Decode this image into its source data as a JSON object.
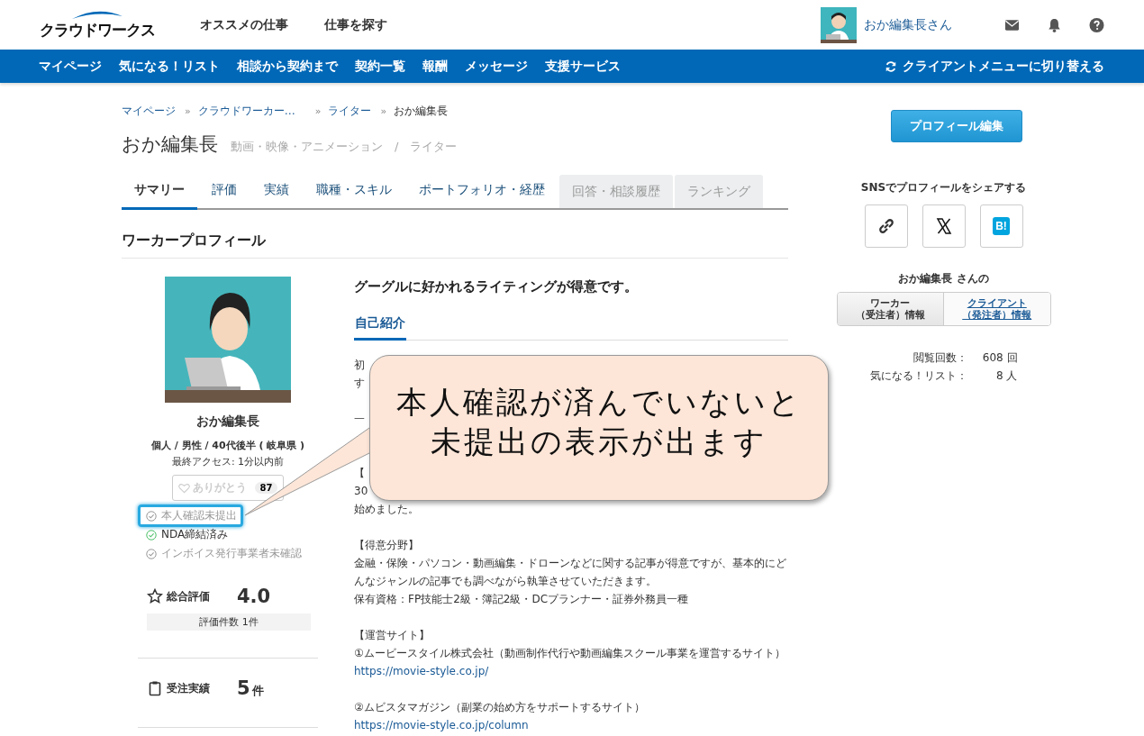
{
  "header": {
    "logo": "クラウドワークス",
    "links": [
      "オススメの仕事",
      "仕事を探す"
    ],
    "user": "おか編集長さん"
  },
  "nav": {
    "items": [
      "マイページ",
      "気になる！リスト",
      "相談から契約まで",
      "契約一覧",
      "報酬",
      "メッセージ",
      "支援サービス"
    ],
    "switch": "クライアントメニューに切り替える"
  },
  "breadcrumb": {
    "separator": "»",
    "items": [
      {
        "label": "マイページ",
        "link": true
      },
      {
        "label": "クラウドワーカー…",
        "link": true
      },
      {
        "label": "ライター",
        "link": true
      },
      {
        "label": "おか編集長",
        "link": false
      }
    ]
  },
  "title": {
    "name": "おか編集長",
    "category": "動画・映像・アニメーション　/　ライター"
  },
  "tabs": [
    {
      "label": "サマリー",
      "selected": true,
      "disabled": false
    },
    {
      "label": "評価",
      "selected": false,
      "disabled": false
    },
    {
      "label": "実績",
      "selected": false,
      "disabled": false
    },
    {
      "label": "職種・スキル",
      "selected": false,
      "disabled": false
    },
    {
      "label": "ポートフォリオ・経歴",
      "selected": false,
      "disabled": false
    },
    {
      "label": "回答・相談履歴",
      "selected": false,
      "disabled": true
    },
    {
      "label": "ランキング",
      "selected": false,
      "disabled": true
    }
  ],
  "section_title": "ワーカープロフィール",
  "profile": {
    "name": "おか編集長",
    "attributes": "個人 / 男性 / 40代後半 ( 岐阜県 )",
    "last_access": "最終アクセス: 1分以内前",
    "thanks": {
      "label": "ありがとう",
      "count": "87"
    },
    "badges": [
      {
        "label": "本人確認未提出",
        "verified": false,
        "highlighted": true
      },
      {
        "label": "NDA締結済み",
        "verified": true,
        "highlighted": false
      },
      {
        "label": "インボイス発行事業者未確認",
        "verified": false,
        "highlighted": false
      }
    ],
    "rating": {
      "label": "総合評価",
      "value": "4.0",
      "count": "評価件数 1件"
    },
    "orders": {
      "label": "受注実績",
      "value": "5",
      "unit": "件"
    }
  },
  "headline": "グーグルに好かれるライティングが得意です。",
  "intro_tab": "自己紹介",
  "bio": [
    {
      "lines": [
        {
          "kind": "text",
          "text": "初"
        },
        {
          "kind": "text",
          "text": "す"
        }
      ]
    },
    {
      "lines": [
        {
          "kind": "text",
          "text": "一"
        }
      ]
    },
    {
      "lines": [
        {
          "kind": "text",
          "text": "【"
        },
        {
          "kind": "text",
          "text": "30"
        },
        {
          "kind": "text",
          "text": "始めました。"
        }
      ]
    },
    {
      "lines": [
        {
          "kind": "text",
          "text": "【得意分野】"
        },
        {
          "kind": "text",
          "text": "金融・保険・パソコン・動画編集・ドローンなどに関する記事が得意ですが、基本的にど"
        },
        {
          "kind": "text",
          "text": "んなジャンルの記事でも調べながら執筆させていただきます。"
        },
        {
          "kind": "text",
          "text": "保有資格：FP技能士2級・簿記2級・DCプランナー・証券外務員一種"
        }
      ]
    },
    {
      "lines": [
        {
          "kind": "text",
          "text": "【運営サイト】"
        },
        {
          "kind": "text",
          "text": "①ムービースタイル株式会社（動画制作代行や動画編集スクール事業を運営するサイト）"
        },
        {
          "kind": "link",
          "text": "https://movie-style.co.jp/"
        }
      ]
    },
    {
      "lines": [
        {
          "kind": "text",
          "text": "②ムビスタマガジン（副業の始め方をサポートするサイト）"
        },
        {
          "kind": "link",
          "text": "https://movie-style.co.jp/column"
        }
      ]
    }
  ],
  "callout": {
    "lines": [
      "本人確認が済んでいないと",
      "未提出の表示が出ます"
    ]
  },
  "sidebar": {
    "edit_button": "プロフィール編集",
    "share_title": "SNSでプロフィールをシェアする",
    "share_buttons": [
      {
        "kind": "link"
      },
      {
        "kind": "x"
      },
      {
        "kind": "hatena",
        "label": "B!"
      }
    ],
    "role_title": "おか編集長 さんの",
    "roles": [
      {
        "lines": [
          "ワーカー",
          "（受注者）情報"
        ],
        "selected": true
      },
      {
        "lines": [
          "クライアント",
          "（発注者）情報"
        ],
        "selected": false
      }
    ],
    "stats": [
      {
        "label": "閲覧回数：",
        "value": "608 回"
      },
      {
        "label": "気になる！リスト：",
        "value": "8 人"
      }
    ]
  }
}
